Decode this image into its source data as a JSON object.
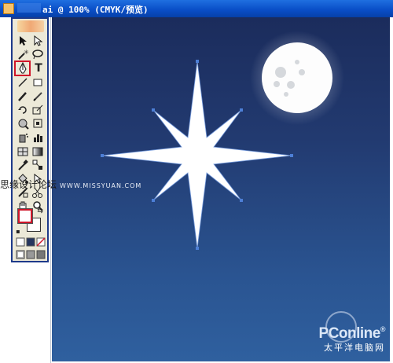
{
  "window": {
    "title_suffix": "ai @ 100% (CMYK/预览)"
  },
  "watermarks": {
    "left_cn": "思缘设计论坛",
    "left_url": "WWW.MISSYUAN.COM",
    "brand": "PConline",
    "brand_sup": "®",
    "brand_cn": "太平洋电脑网"
  },
  "toolbox": {
    "type_tool_glyph": "T",
    "highlighted_tool": "pen-tool"
  },
  "colors": {
    "canvas_top": "#1b2c5c",
    "canvas_bottom": "#2f609f",
    "star": "#ffffff",
    "anchor_point": "#4d7fd6",
    "highlight": "#d0162a",
    "moon": "#fdfdfd"
  }
}
